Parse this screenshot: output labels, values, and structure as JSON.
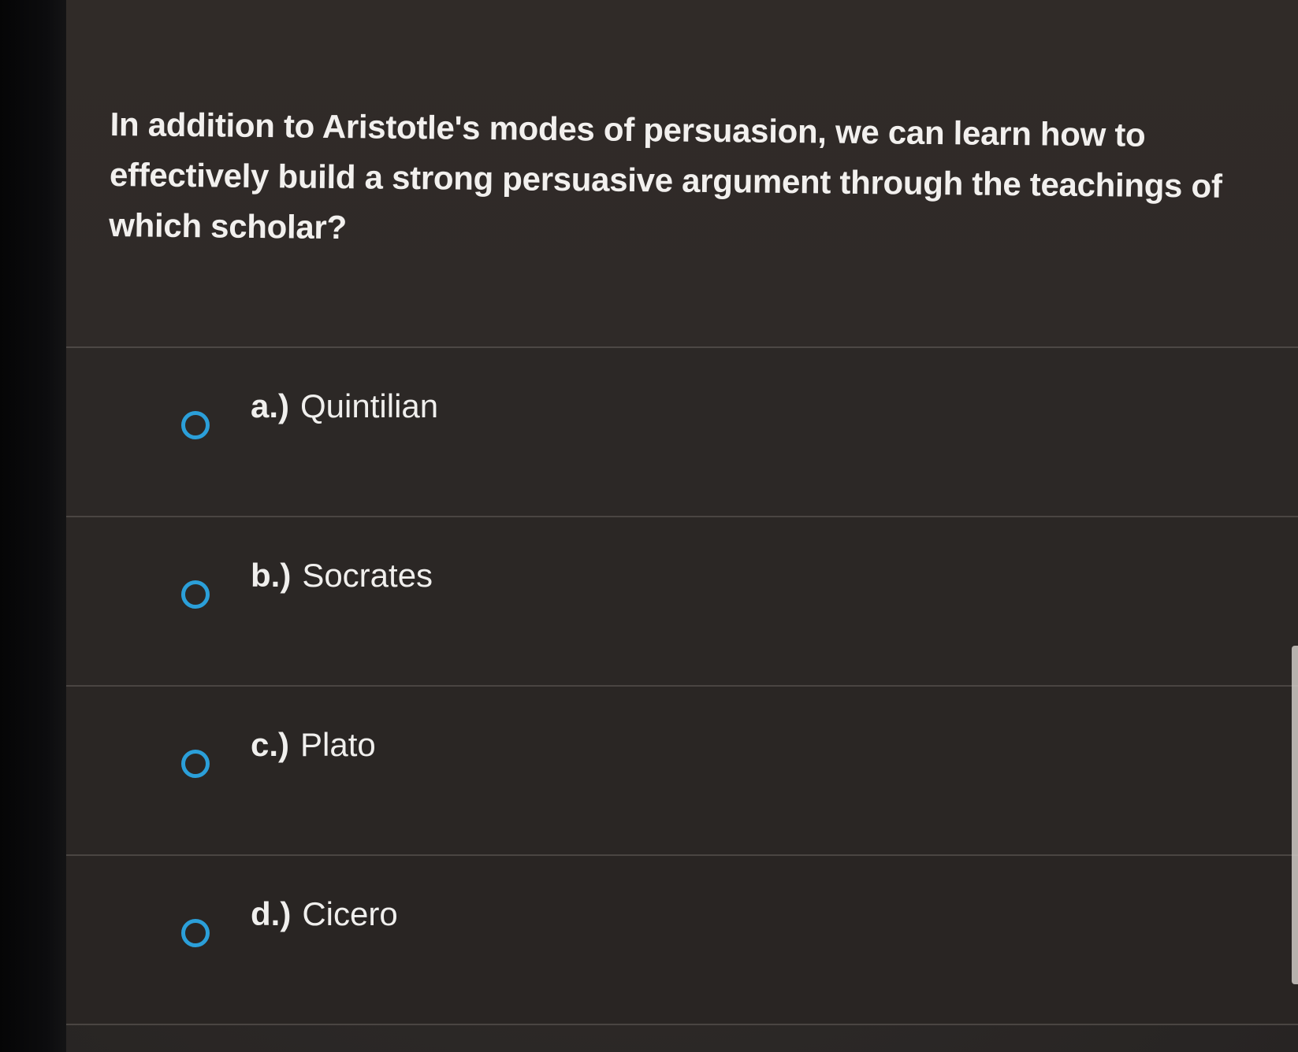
{
  "question": {
    "text": "In addition to Aristotle's modes of persuasion, we can learn how to effectively build a strong persuasive argument through the teachings of which scholar?"
  },
  "options": [
    {
      "letter": "a.)",
      "text": "Quintilian",
      "selected": false
    },
    {
      "letter": "b.)",
      "text": "Socrates",
      "selected": false
    },
    {
      "letter": "c.)",
      "text": "Plato",
      "selected": false
    },
    {
      "letter": "d.)",
      "text": "Cicero",
      "selected": false
    }
  ],
  "colors": {
    "background": "#2f2a28",
    "text": "#f2f0ee",
    "radio_accent": "#2b9fd9",
    "divider": "#4a4542"
  }
}
